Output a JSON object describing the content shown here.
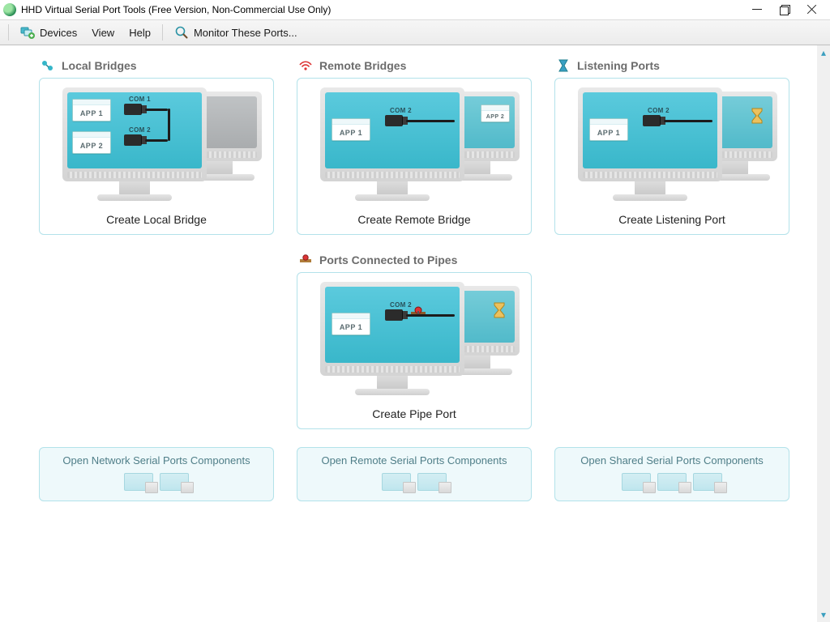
{
  "window": {
    "title": "HHD Virtual Serial Port Tools (Free Version, Non-Commercial Use Only)"
  },
  "toolbar": {
    "devices": "Devices",
    "view": "View",
    "help": "Help",
    "monitor": "Monitor These Ports..."
  },
  "sections": {
    "local": {
      "title": "Local Bridges",
      "action": "Create Local Bridge"
    },
    "remote": {
      "title": "Remote Bridges",
      "action": "Create Remote Bridge"
    },
    "listen": {
      "title": "Listening Ports",
      "action": "Create Listening Port"
    },
    "pipes": {
      "title": "Ports Connected to Pipes",
      "action": "Create Pipe Port"
    }
  },
  "labels": {
    "app1": "APP 1",
    "app2": "APP 2",
    "com1": "COM 1",
    "com2": "COM 2"
  },
  "components": {
    "network": "Open Network Serial Ports Components",
    "remote": "Open Remote Serial Ports Components",
    "shared": "Open Shared Serial Ports Components"
  }
}
